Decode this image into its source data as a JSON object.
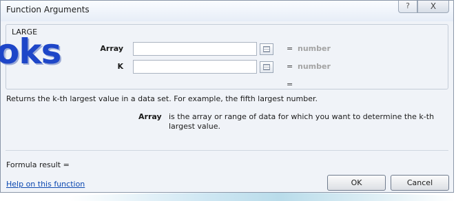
{
  "dialog": {
    "title": "Function Arguments",
    "help_glyph": "?",
    "close_glyph": "X"
  },
  "function_group": {
    "name": "LARGE",
    "args": [
      {
        "label": "Array",
        "value": "",
        "result": "number"
      },
      {
        "label": "K",
        "value": "",
        "result": "number"
      }
    ],
    "eq_sign": "=",
    "overall_result": "="
  },
  "description": "Returns the k-th largest value in a data set. For example, the fifth largest number.",
  "arg_help": {
    "label": "Array",
    "text": "is the array or range of data for which you want to determine the k-th largest value."
  },
  "formula_result_label": "Formula result =",
  "help_link": "Help on this function",
  "buttons": {
    "ok": "OK",
    "cancel": "Cancel"
  },
  "watermark": "oks"
}
